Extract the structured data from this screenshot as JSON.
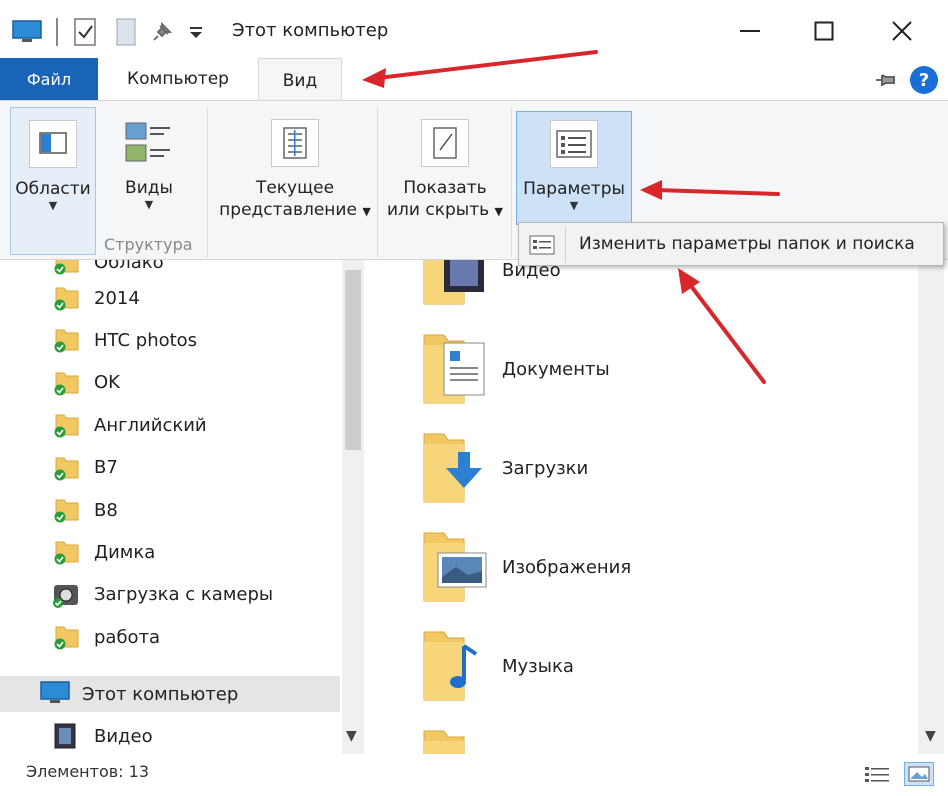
{
  "window": {
    "title": "Этот компьютер"
  },
  "tabs": {
    "file": "Файл",
    "computer": "Компьютер",
    "view": "Вид"
  },
  "ribbon": {
    "areas_label": "Области",
    "views_label": "Виды",
    "structure_group_label": "Структура",
    "current_view_line1": "Текущее",
    "current_view_line2": "представление",
    "show_hide_line1": "Показать",
    "show_hide_line2": "или скрыть",
    "parameters_label": "Параметры"
  },
  "dropdown": {
    "change_options_label": "Изменить параметры папок и поиска"
  },
  "nav": {
    "partial_label": "Облако",
    "items": [
      {
        "label": "2014",
        "icon": "folder-sync-icon"
      },
      {
        "label": "HTC photos",
        "icon": "folder-sync-icon"
      },
      {
        "label": "OK",
        "icon": "folder-sync-icon"
      },
      {
        "label": "Английский",
        "icon": "folder-sync-icon"
      },
      {
        "label": "В7",
        "icon": "folder-sync-icon"
      },
      {
        "label": "В8",
        "icon": "folder-sync-icon"
      },
      {
        "label": "Димка",
        "icon": "folder-sync-icon"
      },
      {
        "label": "Загрузка с камеры",
        "icon": "camera-folder-icon"
      },
      {
        "label": "работа",
        "icon": "folder-sync-icon"
      }
    ],
    "this_pc": "Этот компьютер",
    "video": "Видео"
  },
  "content": {
    "items": [
      {
        "label": "Видео",
        "icon": "video-folder-icon"
      },
      {
        "label": "Документы",
        "icon": "documents-folder-icon"
      },
      {
        "label": "Загрузки",
        "icon": "downloads-folder-icon"
      },
      {
        "label": "Изображения",
        "icon": "pictures-folder-icon"
      },
      {
        "label": "Музыка",
        "icon": "music-folder-icon"
      }
    ]
  },
  "status": {
    "items_count": "Элементов: 13"
  },
  "colors": {
    "file_tab": "#1a64b8",
    "annotation_arrow": "#d8262a",
    "folder": "#f2c862",
    "selected": "#cde2f7"
  }
}
